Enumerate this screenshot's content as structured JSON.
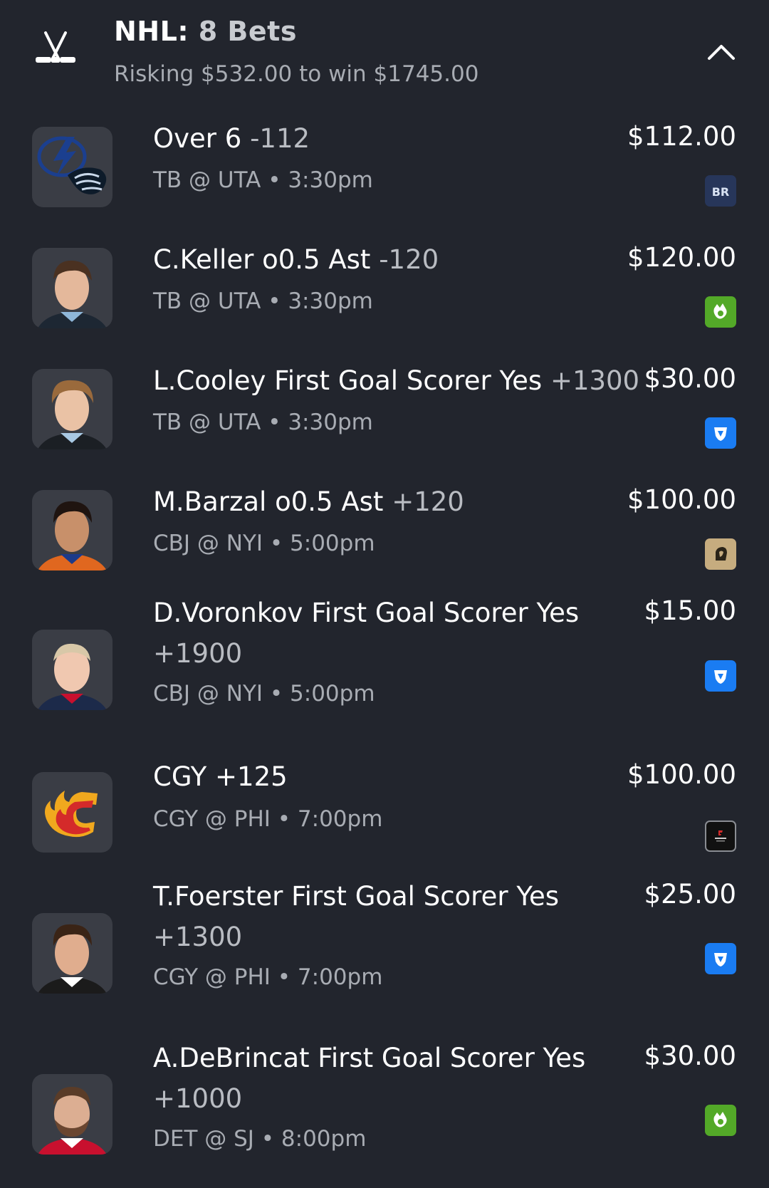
{
  "header": {
    "league": "NHL:",
    "bet_count": "8 Bets",
    "summary": "Risking $532.00 to win $1745.00",
    "sport_icon": "hockey-sticks-icon",
    "collapse_icon": "chevron-up-icon"
  },
  "colors": {
    "background": "#22252d",
    "thumb_bg": "#3a3d45",
    "primary_text": "#ffffff",
    "secondary_text": "#a8acb3",
    "odds_text": "#b9bcc2"
  },
  "bets": [
    {
      "selection": "Over 6",
      "odds": "-112",
      "game": "TB @ UTA • 3:30pm",
      "stake": "$112.00",
      "book": "BetRivers",
      "book_icon": "betrivers-logo-icon",
      "thumb": "lightning-mammoth-logos"
    },
    {
      "selection": "C.Keller o0.5 Ast",
      "odds": "-120",
      "game": "TB @ UTA • 3:30pm",
      "stake": "$120.00",
      "book": "DraftKings",
      "book_icon": "draftkings-logo-icon",
      "thumb": "player-headshot"
    },
    {
      "selection": "L.Cooley First Goal Scorer Yes",
      "odds": "+1300",
      "game": "TB @ UTA • 3:30pm",
      "stake": "$30.00",
      "book": "FanDuel",
      "book_icon": "fanduel-logo-icon",
      "thumb": "player-headshot"
    },
    {
      "selection": "M.Barzal o0.5 Ast",
      "odds": "+120",
      "game": "CBJ @ NYI • 5:00pm",
      "stake": "$100.00",
      "book": "BetMGM",
      "book_icon": "betmgm-logo-icon",
      "thumb": "player-headshot"
    },
    {
      "selection": "D.Voronkov First Goal Scorer Yes",
      "odds": "+1900",
      "game": "CBJ @ NYI • 5:00pm",
      "stake": "$15.00",
      "book": "FanDuel",
      "book_icon": "fanduel-logo-icon",
      "thumb": "player-headshot"
    },
    {
      "selection": "CGY",
      "odds": "+125",
      "game": "CGY @ PHI • 7:00pm",
      "stake": "$100.00",
      "book": "Fanatics",
      "book_icon": "fanatics-logo-icon",
      "thumb": "flames-logo"
    },
    {
      "selection": "T.Foerster First Goal Scorer Yes",
      "odds": "+1300",
      "game": "CGY @ PHI • 7:00pm",
      "stake": "$25.00",
      "book": "FanDuel",
      "book_icon": "fanduel-logo-icon",
      "thumb": "player-headshot"
    },
    {
      "selection": "A.DeBrincat First Goal Scorer Yes",
      "odds": "+1000",
      "game": "DET @ SJ • 8:00pm",
      "stake": "$30.00",
      "book": "DraftKings",
      "book_icon": "draftkings-logo-icon",
      "thumb": "player-headshot"
    }
  ]
}
